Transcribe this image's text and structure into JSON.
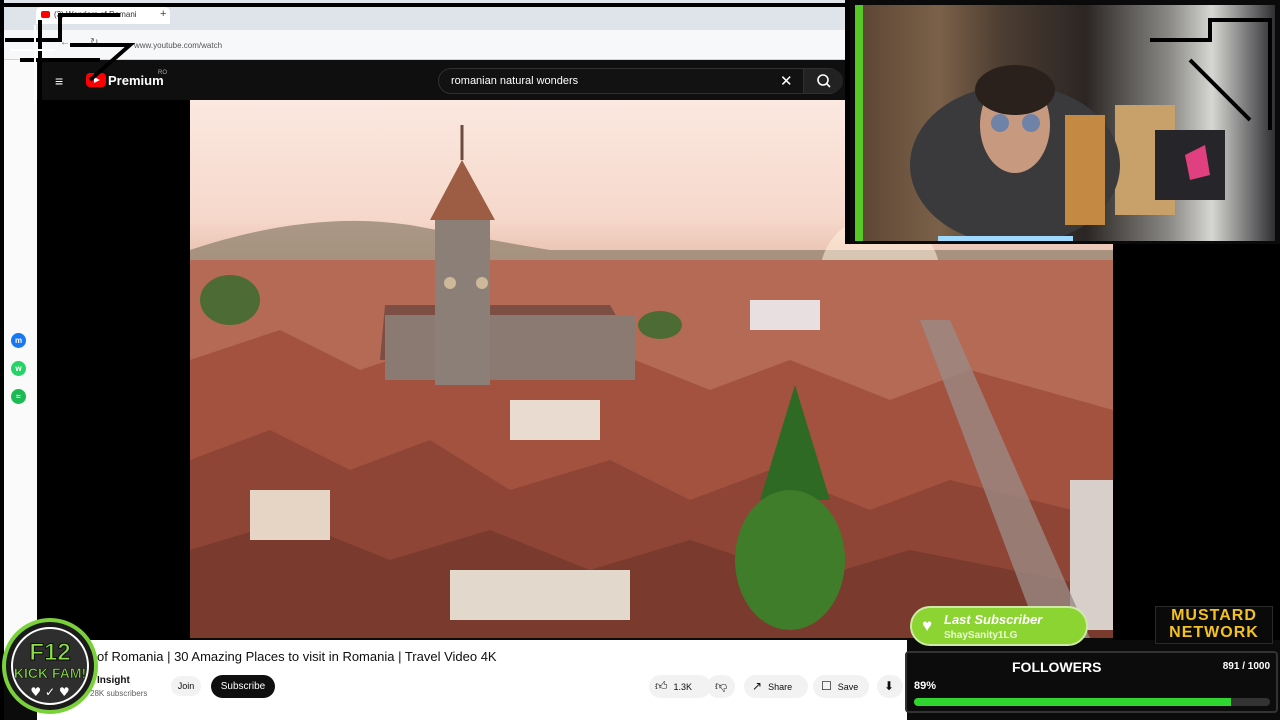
{
  "browser": {
    "tab_title": "(3) Wonders of Romani",
    "new_tab": "+",
    "url": "www.youtube.com/watch"
  },
  "youtube": {
    "brand": "Premium",
    "region": "RO",
    "search_value": "romanian natural wonders",
    "clear_icon": "✕",
    "search_icon": "search-icon",
    "menu_icon": "≡"
  },
  "video": {
    "title": "of Romania | 30 Amazing Places to visit in Romania | Travel Video 4K",
    "channel": "Insight",
    "subscribers": "28K subscribers",
    "join": "Join",
    "subscribe": "Subscribe",
    "likes": "1.3K",
    "share": "Share",
    "save": "Save"
  },
  "overlay": {
    "last_subscriber_label": "Last Subscriber",
    "last_subscriber_name": "ShaySanity1LG",
    "network_line1": "MUSTARD",
    "network_line2": "NETWORK",
    "followers_label": "FOLLOWERS",
    "followers_count": "891 / 1000",
    "followers_percent": "89%",
    "followers_progress": 0.89,
    "badge_line1": "F12",
    "badge_line2": "KICK FAM!"
  },
  "colors": {
    "youtube_red": "#ff0000",
    "progress_green": "#2fd62f",
    "subscriber_green": "#8bd432",
    "mustard": "#f3c21f"
  }
}
